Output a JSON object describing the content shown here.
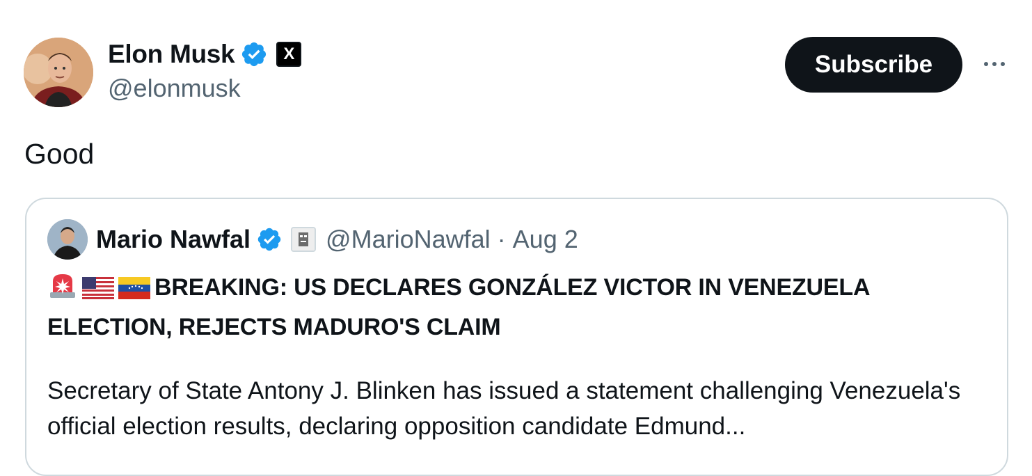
{
  "author": {
    "display_name": "Elon Musk",
    "handle": "@elonmusk",
    "verified": true,
    "affiliate_badge": "X"
  },
  "actions": {
    "subscribe_label": "Subscribe",
    "more_label": "More"
  },
  "tweet": {
    "text": "Good"
  },
  "quoted": {
    "display_name": "Mario Nawfal",
    "handle": "@MarioNawfal",
    "separator": "·",
    "date": "Aug 2",
    "verified": true,
    "headline_emojis": [
      "rotating-light-icon",
      "us-flag-icon",
      "venezuela-flag-icon"
    ],
    "headline": "BREAKING: US DECLARES GONZÁLEZ VICTOR IN VENEZUELA ELECTION, REJECTS MADURO'S CLAIM",
    "body": "Secretary of State Antony J. Blinken has issued a statement challenging Venezuela's official election results, declaring opposition candidate Edmund..."
  },
  "colors": {
    "verified_blue": "#1d9bf0",
    "text_primary": "#0f1419",
    "text_secondary": "#536471",
    "border": "#cfd9de",
    "button_bg": "#0f1419"
  }
}
